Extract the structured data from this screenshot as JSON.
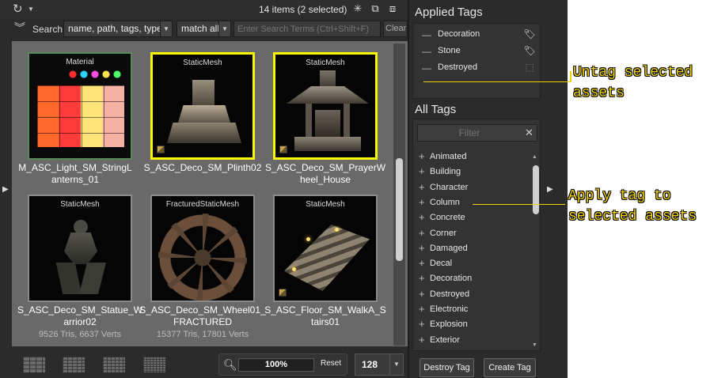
{
  "toolbar": {
    "item_count": "14 items (2 selected)",
    "icons": [
      "sync-icon",
      "new-collection-icon",
      "collection-view-icon",
      "tag-view-icon"
    ]
  },
  "search": {
    "label": "Search",
    "scope_value": "name, path, tags, type",
    "match_value": "match all",
    "placeholder": "Enter Search Terms (Ctrl+Shift+F)",
    "clear_label": "Clear"
  },
  "assets": [
    {
      "type": "Material",
      "name": "M_ASC_Light_SM_StringLanterns_01",
      "stats": "",
      "selected": false
    },
    {
      "type": "StaticMesh",
      "name": "S_ASC_Deco_SM_Plinth02",
      "stats": "",
      "selected": true
    },
    {
      "type": "StaticMesh",
      "name": "S_ASC_Deco_SM_PrayerWheel_House",
      "stats": "",
      "selected": true
    },
    {
      "type": "StaticMesh",
      "name": "S_ASC_Deco_SM_Statue_Warrior02",
      "stats": "9526 Tris, 6637 Verts",
      "selected": false
    },
    {
      "type": "FracturedStaticMesh",
      "name": "S_ASC_Deco_SM_Wheel01_FRACTURED",
      "stats": "15377 Tris, 17801 Verts",
      "selected": false
    },
    {
      "type": "StaticMesh",
      "name": "S_ASC_Floor_SM_WalkA_Stairs01",
      "stats": "",
      "selected": false
    }
  ],
  "bottom": {
    "zoom_value": "100%",
    "zoom_fraction": 1.0,
    "reset_label": "Reset",
    "thumb_size": "128"
  },
  "tags": {
    "applied_title": "Applied Tags",
    "applied": [
      {
        "label": "Decoration",
        "icon": "tag-icon"
      },
      {
        "label": "Stone",
        "icon": "tag-icon"
      },
      {
        "label": "Destroyed",
        "icon": "tag-partial-icon"
      }
    ],
    "all_title": "All Tags",
    "filter_placeholder": "Filter",
    "all": [
      "Animated",
      "Building",
      "Character",
      "Column",
      "Concrete",
      "Corner",
      "Damaged",
      "Decal",
      "Decoration",
      "Destroyed",
      "Electronic",
      "Explosion",
      "Exterior"
    ],
    "destroy_label": "Destroy Tag",
    "create_label": "Create Tag"
  },
  "annotations": {
    "untag": "Untag selected\nassets",
    "apply": "Apply tag to\nselected assets"
  },
  "colors": {
    "selection": "#f7f700",
    "callout": "#f2d200",
    "panel_bg": "#2b2b2b",
    "grid_bg": "#696969"
  }
}
